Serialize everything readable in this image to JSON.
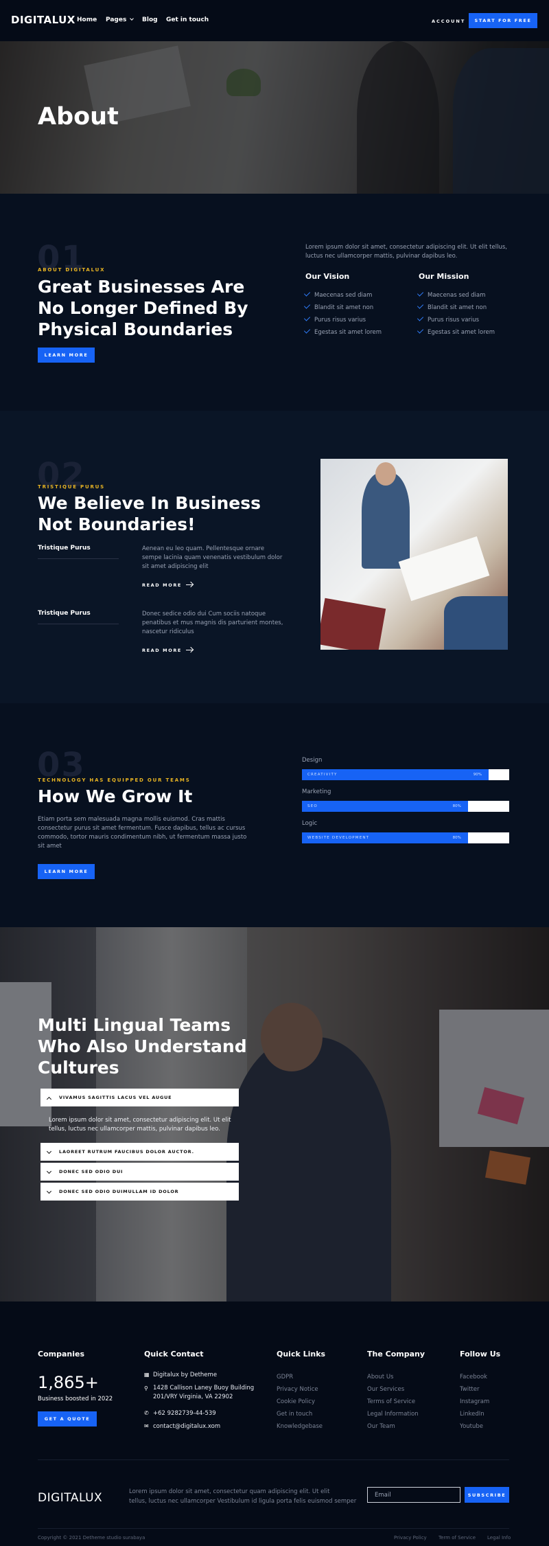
{
  "header": {
    "logo": "DIGITALUX",
    "nav": [
      "Home",
      "Pages",
      "Blog",
      "Get in touch"
    ],
    "account": "ACCOUNT",
    "cta": "START FOR FREE"
  },
  "hero": {
    "title": "About"
  },
  "about": {
    "number": "01",
    "eyebrow": "ABOUT DIGITALUX",
    "title_lines": [
      "Great Businesses Are",
      "No Longer Defined By",
      "Physical Boundaries"
    ],
    "button": "LEARN MORE",
    "intro_lines": [
      "Lorem ipsum dolor sit amet, consectetur adipiscing elit. Ut elit tellus,",
      "luctus nec ullamcorper mattis, pulvinar dapibus leo."
    ],
    "vision_title": "Our Vision",
    "vision_items": [
      "Maecenas sed diam",
      "Blandit sit amet non",
      "Purus risus varius",
      "Egestas sit amet lorem"
    ],
    "mission_title": "Our Mission",
    "mission_items": [
      "Maecenas sed diam",
      "Blandit sit amet non",
      "Purus risus varius",
      "Egestas sit amet lorem"
    ]
  },
  "believe": {
    "number": "02",
    "eyebrow": "TRISTIQUE PURUS",
    "title_lines": [
      "We Believe In Business",
      "Not Boundaries!"
    ],
    "items": [
      {
        "label": "Tristique Purus",
        "text_lines": [
          "Aenean eu leo quam. Pellentesque ornare",
          "sempe lacinia quam venenatis vestibulum dolor",
          "sit amet adipiscing elit"
        ],
        "link": "READ MORE"
      },
      {
        "label": "Tristique Purus",
        "text_lines": [
          "Donec sedice odio dui Cum sociis natoque",
          "penatibus et mus magnis dis parturient montes,",
          "nascetur ridiculus"
        ],
        "link": "READ MORE"
      }
    ]
  },
  "grow": {
    "number": "03",
    "eyebrow": "TECHNOLOGY HAS EQUIPPED OUR TEAMS",
    "title": "How We Grow It",
    "text_lines": [
      "Etiam porta sem malesuada magna mollis euismod. Cras mattis",
      "consectetur purus sit amet fermentum. Fusce dapibus, tellus ac cursus",
      "commodo, tortor mauris condimentum nibh, ut fermentum massa justo",
      "sit amet"
    ],
    "button": "LEARN MORE",
    "bars": [
      {
        "label": "Design",
        "name": "CREATIVITY",
        "percent": 90,
        "percent_text": "90%"
      },
      {
        "label": "Marketing",
        "name": "SEO",
        "percent": 80,
        "percent_text": "80%"
      },
      {
        "label": "Logic",
        "name": "WEBSITE DEVELOPMENT",
        "percent": 80,
        "percent_text": "80%"
      }
    ]
  },
  "teams": {
    "title_lines": [
      "Multi Lingual Teams",
      "Who Also Understand",
      "Cultures"
    ],
    "accordion": [
      {
        "title": "VIVAMUS SAGITTIS LACUS VEL AUGUE",
        "open": true
      },
      {
        "title": "LAOREET RUTRUM FAUCIBUS DOLOR AUCTOR.",
        "open": false
      },
      {
        "title": "DONEC SED ODIO DUI",
        "open": false
      },
      {
        "title": "DONEC SED ODIO DUIMULLAM ID DOLOR",
        "open": false
      }
    ],
    "open_text_lines": [
      "Lorem ipsum dolor sit amet, consectetur adipiscing elit. Ut elit",
      "tellus, luctus nec ullamcorper mattis, pulvinar dapibus leo."
    ]
  },
  "footer": {
    "companies_title": "Companies",
    "companies_count": "1,865+",
    "companies_caption": "Business boosted in 2022",
    "quote_button": "GET A QUOTE",
    "contact_title": "Quick Contact",
    "contact_name": "Digitalux by Detheme",
    "address_lines": [
      "1428 Callison Laney Buoy Building",
      "201/VRY Virginia, VA 22902"
    ],
    "phone": "+62 9282739-44-539",
    "email": "contact@digitalux.xom",
    "quick_title": "Quick Links",
    "quick_links": [
      "GDPR",
      "Privacy Notice",
      "Cookie Policy",
      "Get in touch",
      "Knowledgebase"
    ],
    "company_title": "The Company",
    "company_links": [
      "About Us",
      "Our Services",
      "Terms of Service",
      "Legal Information",
      "Our Team"
    ],
    "follow_title": "Follow Us",
    "follow_links": [
      "Facebook",
      "Twitter",
      "Instagram",
      "LinkedIn",
      "Youtube"
    ],
    "logo": "DIGITALUX",
    "blurb_lines": [
      "Lorem ipsum dolor sit amet, consectetur quam adipiscing elit. Ut elit",
      "tellus, luctus nec ullamcorper Vestibulum id ligula porta felis euismod semper"
    ],
    "email_placeholder": "Email",
    "subscribe": "SUBSCRIBE",
    "copyright": "Copyright © 2021 Detheme studio surabaya",
    "legal_links": [
      "Privacy Policy",
      "Term of Service",
      "Legal Info"
    ]
  }
}
